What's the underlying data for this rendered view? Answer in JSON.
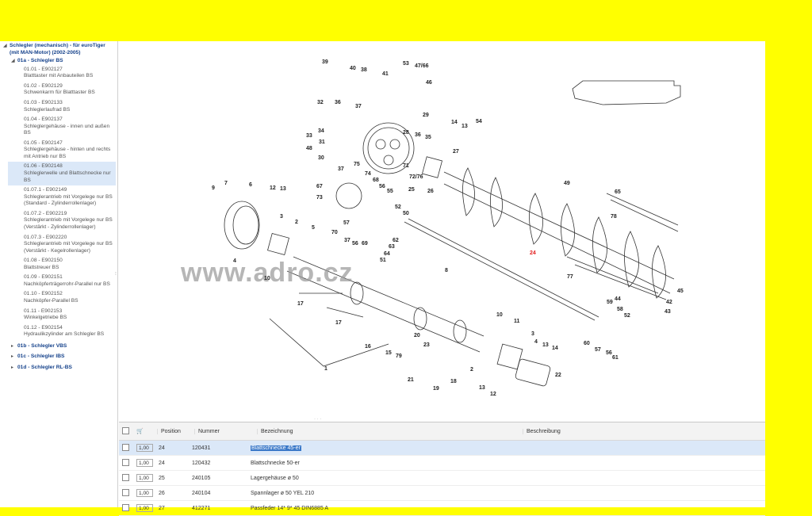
{
  "tree": {
    "root": "Schlegler (mechanisch) - für euroTiger (mit MAN-Motor) (2002-2005)",
    "group": "01a - Schlegler BS",
    "leaves": [
      {
        "code": "01.01 - E902127",
        "name": "Blatttaster mit Anbauteilen BS"
      },
      {
        "code": "01.02 - E902129",
        "name": "Schwenkarm für Blatttaster BS"
      },
      {
        "code": "01.03 - E902133",
        "name": "Schleglerlaufrad BS"
      },
      {
        "code": "01.04 - E902137",
        "name": "Schleglergehäuse - innen und außen BS"
      },
      {
        "code": "01.05 - E902147",
        "name": "Schleglergehäuse - hinten und rechts mit Antrieb nur BS"
      },
      {
        "code": "01.06 - E902148",
        "name": "Schleglerwelle und Blattschnecke nur BS"
      },
      {
        "code": "01.07.1 - E902149",
        "name": "Schleglerantrieb mit Vorgelege nur BS (Standard - Zylinderrollenlager)"
      },
      {
        "code": "01.07.2 - E902219",
        "name": "Schleglerantrieb mit Vorgelege nur BS (Verstärkt - Zylinderrollenlager)"
      },
      {
        "code": "01.07.3 - E902220",
        "name": "Schleglerantrieb mit Vorgelege nur BS (Verstärkt - Kegelrollenlager)"
      },
      {
        "code": "01.08 - E902150",
        "name": "Blattstreuer BS"
      },
      {
        "code": "01.09 - E902151",
        "name": "Nachköpferträgerrohr-Parallel nur BS"
      },
      {
        "code": "01.10 - E902152",
        "name": "Nachköpfer-Parallel BS"
      },
      {
        "code": "01.11 - E902153",
        "name": "Winkelgetriebe BS"
      },
      {
        "code": "01.12 - E902154",
        "name": "Hydraulikzylinder am Schlegler BS"
      }
    ],
    "collapsed": [
      "01b - Schlegler VBS",
      "01c - Schlegler IBS",
      "01d - Schlegler RL-BS"
    ]
  },
  "diagram": {
    "watermark": "www.adro.cz",
    "callouts": [
      "39",
      "40",
      "38",
      "41",
      "53",
      "47/66",
      "46",
      "32",
      "36",
      "37",
      "29",
      "34",
      "33",
      "31",
      "48",
      "30",
      "28",
      "36",
      "35",
      "14",
      "13",
      "54",
      "27",
      "71",
      "72/76",
      "25",
      "26",
      "75",
      "74",
      "68",
      "37",
      "56",
      "55",
      "67",
      "73",
      "52",
      "50",
      "49",
      "65",
      "78",
      "24",
      "7",
      "6",
      "12",
      "13",
      "9",
      "3",
      "2",
      "5",
      "57",
      "70",
      "37",
      "56",
      "69",
      "62",
      "63",
      "64",
      "51",
      "8",
      "77",
      "44",
      "45",
      "42",
      "43",
      "4",
      "10",
      "1",
      "17",
      "17",
      "59",
      "58",
      "52",
      "60",
      "57",
      "56",
      "61",
      "10",
      "11",
      "3",
      "4",
      "13",
      "14",
      "16",
      "15",
      "20",
      "23",
      "79",
      "21",
      "18",
      "19",
      "2",
      "22",
      "13",
      "12"
    ]
  },
  "grid": {
    "headers": {
      "position": "Position",
      "nummer": "Nummer",
      "bezeichnung": "Bezeichnung",
      "beschreibung": "Beschreibung"
    },
    "rows": [
      {
        "qty": "1,00",
        "position": "24",
        "nummer": "120431",
        "bezeichnung": "Blattschnecke 45-er",
        "beschreibung": ""
      },
      {
        "qty": "1,00",
        "position": "24",
        "nummer": "120432",
        "bezeichnung": "Blattschnecke 50-er",
        "beschreibung": ""
      },
      {
        "qty": "1,00",
        "position": "25",
        "nummer": "240105",
        "bezeichnung": "Lagergehäuse ø 50",
        "beschreibung": ""
      },
      {
        "qty": "1,00",
        "position": "26",
        "nummer": "240104",
        "bezeichnung": "Spannlager ø 50 YEL 210",
        "beschreibung": ""
      },
      {
        "qty": "1,00",
        "position": "27",
        "nummer": "412271",
        "bezeichnung": "Passfeder 14* 9* 45 DIN6885 A",
        "beschreibung": ""
      }
    ]
  },
  "colors": {
    "frame": "#ffff00",
    "selected": "#dbe8f8",
    "link": "#15428b",
    "highlight": "#3a78c8"
  }
}
